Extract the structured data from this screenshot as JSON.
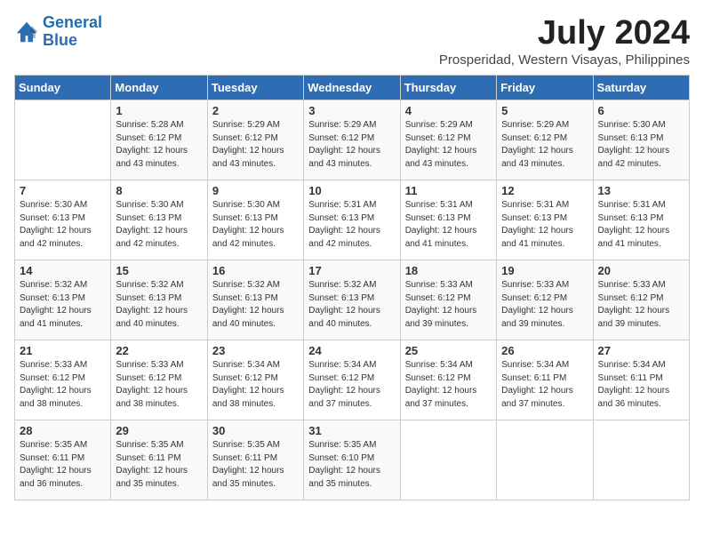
{
  "logo": {
    "line1": "General",
    "line2": "Blue"
  },
  "title": "July 2024",
  "location": "Prosperidad, Western Visayas, Philippines",
  "headers": [
    "Sunday",
    "Monday",
    "Tuesday",
    "Wednesday",
    "Thursday",
    "Friday",
    "Saturday"
  ],
  "weeks": [
    [
      {
        "day": "",
        "sunrise": "",
        "sunset": "",
        "daylight": ""
      },
      {
        "day": "1",
        "sunrise": "Sunrise: 5:28 AM",
        "sunset": "Sunset: 6:12 PM",
        "daylight": "Daylight: 12 hours and 43 minutes."
      },
      {
        "day": "2",
        "sunrise": "Sunrise: 5:29 AM",
        "sunset": "Sunset: 6:12 PM",
        "daylight": "Daylight: 12 hours and 43 minutes."
      },
      {
        "day": "3",
        "sunrise": "Sunrise: 5:29 AM",
        "sunset": "Sunset: 6:12 PM",
        "daylight": "Daylight: 12 hours and 43 minutes."
      },
      {
        "day": "4",
        "sunrise": "Sunrise: 5:29 AM",
        "sunset": "Sunset: 6:12 PM",
        "daylight": "Daylight: 12 hours and 43 minutes."
      },
      {
        "day": "5",
        "sunrise": "Sunrise: 5:29 AM",
        "sunset": "Sunset: 6:12 PM",
        "daylight": "Daylight: 12 hours and 43 minutes."
      },
      {
        "day": "6",
        "sunrise": "Sunrise: 5:30 AM",
        "sunset": "Sunset: 6:13 PM",
        "daylight": "Daylight: 12 hours and 42 minutes."
      }
    ],
    [
      {
        "day": "7",
        "sunrise": "Sunrise: 5:30 AM",
        "sunset": "Sunset: 6:13 PM",
        "daylight": "Daylight: 12 hours and 42 minutes."
      },
      {
        "day": "8",
        "sunrise": "Sunrise: 5:30 AM",
        "sunset": "Sunset: 6:13 PM",
        "daylight": "Daylight: 12 hours and 42 minutes."
      },
      {
        "day": "9",
        "sunrise": "Sunrise: 5:30 AM",
        "sunset": "Sunset: 6:13 PM",
        "daylight": "Daylight: 12 hours and 42 minutes."
      },
      {
        "day": "10",
        "sunrise": "Sunrise: 5:31 AM",
        "sunset": "Sunset: 6:13 PM",
        "daylight": "Daylight: 12 hours and 42 minutes."
      },
      {
        "day": "11",
        "sunrise": "Sunrise: 5:31 AM",
        "sunset": "Sunset: 6:13 PM",
        "daylight": "Daylight: 12 hours and 41 minutes."
      },
      {
        "day": "12",
        "sunrise": "Sunrise: 5:31 AM",
        "sunset": "Sunset: 6:13 PM",
        "daylight": "Daylight: 12 hours and 41 minutes."
      },
      {
        "day": "13",
        "sunrise": "Sunrise: 5:31 AM",
        "sunset": "Sunset: 6:13 PM",
        "daylight": "Daylight: 12 hours and 41 minutes."
      }
    ],
    [
      {
        "day": "14",
        "sunrise": "Sunrise: 5:32 AM",
        "sunset": "Sunset: 6:13 PM",
        "daylight": "Daylight: 12 hours and 41 minutes."
      },
      {
        "day": "15",
        "sunrise": "Sunrise: 5:32 AM",
        "sunset": "Sunset: 6:13 PM",
        "daylight": "Daylight: 12 hours and 40 minutes."
      },
      {
        "day": "16",
        "sunrise": "Sunrise: 5:32 AM",
        "sunset": "Sunset: 6:13 PM",
        "daylight": "Daylight: 12 hours and 40 minutes."
      },
      {
        "day": "17",
        "sunrise": "Sunrise: 5:32 AM",
        "sunset": "Sunset: 6:13 PM",
        "daylight": "Daylight: 12 hours and 40 minutes."
      },
      {
        "day": "18",
        "sunrise": "Sunrise: 5:33 AM",
        "sunset": "Sunset: 6:12 PM",
        "daylight": "Daylight: 12 hours and 39 minutes."
      },
      {
        "day": "19",
        "sunrise": "Sunrise: 5:33 AM",
        "sunset": "Sunset: 6:12 PM",
        "daylight": "Daylight: 12 hours and 39 minutes."
      },
      {
        "day": "20",
        "sunrise": "Sunrise: 5:33 AM",
        "sunset": "Sunset: 6:12 PM",
        "daylight": "Daylight: 12 hours and 39 minutes."
      }
    ],
    [
      {
        "day": "21",
        "sunrise": "Sunrise: 5:33 AM",
        "sunset": "Sunset: 6:12 PM",
        "daylight": "Daylight: 12 hours and 38 minutes."
      },
      {
        "day": "22",
        "sunrise": "Sunrise: 5:33 AM",
        "sunset": "Sunset: 6:12 PM",
        "daylight": "Daylight: 12 hours and 38 minutes."
      },
      {
        "day": "23",
        "sunrise": "Sunrise: 5:34 AM",
        "sunset": "Sunset: 6:12 PM",
        "daylight": "Daylight: 12 hours and 38 minutes."
      },
      {
        "day": "24",
        "sunrise": "Sunrise: 5:34 AM",
        "sunset": "Sunset: 6:12 PM",
        "daylight": "Daylight: 12 hours and 37 minutes."
      },
      {
        "day": "25",
        "sunrise": "Sunrise: 5:34 AM",
        "sunset": "Sunset: 6:12 PM",
        "daylight": "Daylight: 12 hours and 37 minutes."
      },
      {
        "day": "26",
        "sunrise": "Sunrise: 5:34 AM",
        "sunset": "Sunset: 6:11 PM",
        "daylight": "Daylight: 12 hours and 37 minutes."
      },
      {
        "day": "27",
        "sunrise": "Sunrise: 5:34 AM",
        "sunset": "Sunset: 6:11 PM",
        "daylight": "Daylight: 12 hours and 36 minutes."
      }
    ],
    [
      {
        "day": "28",
        "sunrise": "Sunrise: 5:35 AM",
        "sunset": "Sunset: 6:11 PM",
        "daylight": "Daylight: 12 hours and 36 minutes."
      },
      {
        "day": "29",
        "sunrise": "Sunrise: 5:35 AM",
        "sunset": "Sunset: 6:11 PM",
        "daylight": "Daylight: 12 hours and 35 minutes."
      },
      {
        "day": "30",
        "sunrise": "Sunrise: 5:35 AM",
        "sunset": "Sunset: 6:11 PM",
        "daylight": "Daylight: 12 hours and 35 minutes."
      },
      {
        "day": "31",
        "sunrise": "Sunrise: 5:35 AM",
        "sunset": "Sunset: 6:10 PM",
        "daylight": "Daylight: 12 hours and 35 minutes."
      },
      {
        "day": "",
        "sunrise": "",
        "sunset": "",
        "daylight": ""
      },
      {
        "day": "",
        "sunrise": "",
        "sunset": "",
        "daylight": ""
      },
      {
        "day": "",
        "sunrise": "",
        "sunset": "",
        "daylight": ""
      }
    ]
  ]
}
